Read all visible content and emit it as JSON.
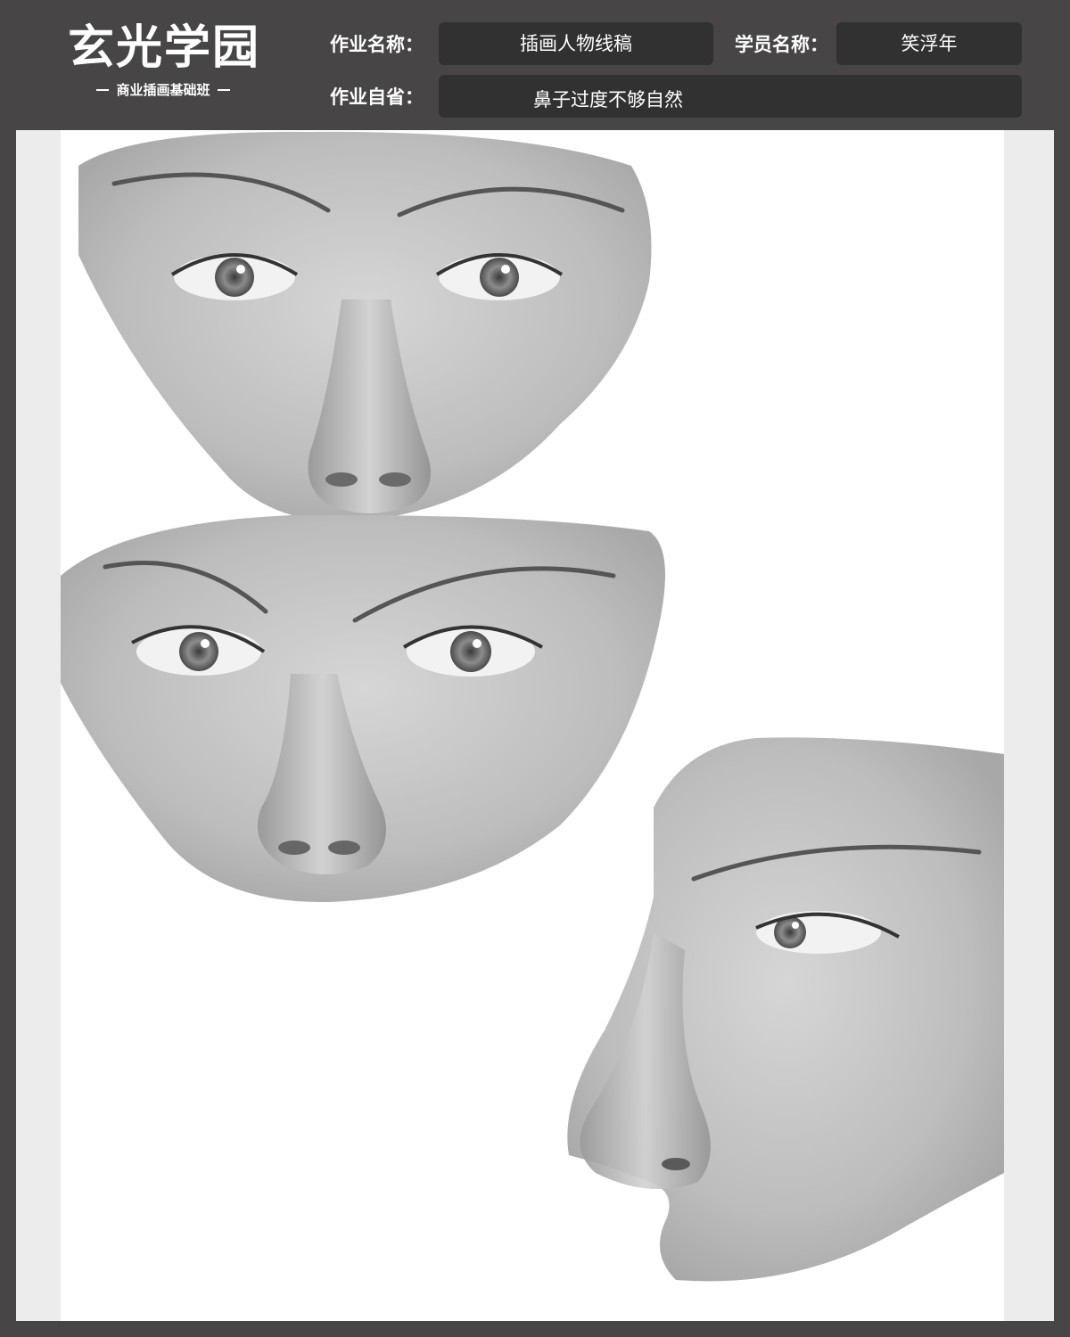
{
  "brand": {
    "title": "玄光学园",
    "subtitle": "商业插画基础班"
  },
  "form": {
    "assignment_label": "作业名称：",
    "assignment_value": "插画人物线稿",
    "student_label": "学员名称：",
    "student_value": "笑浮年",
    "reflection_label": "作业自省：",
    "reflection_value": "鼻子过度不够自然"
  },
  "colors": {
    "frame": "#474546",
    "field": "#323132",
    "canvas_margin": "#ececec",
    "canvas": "#ffffff"
  }
}
